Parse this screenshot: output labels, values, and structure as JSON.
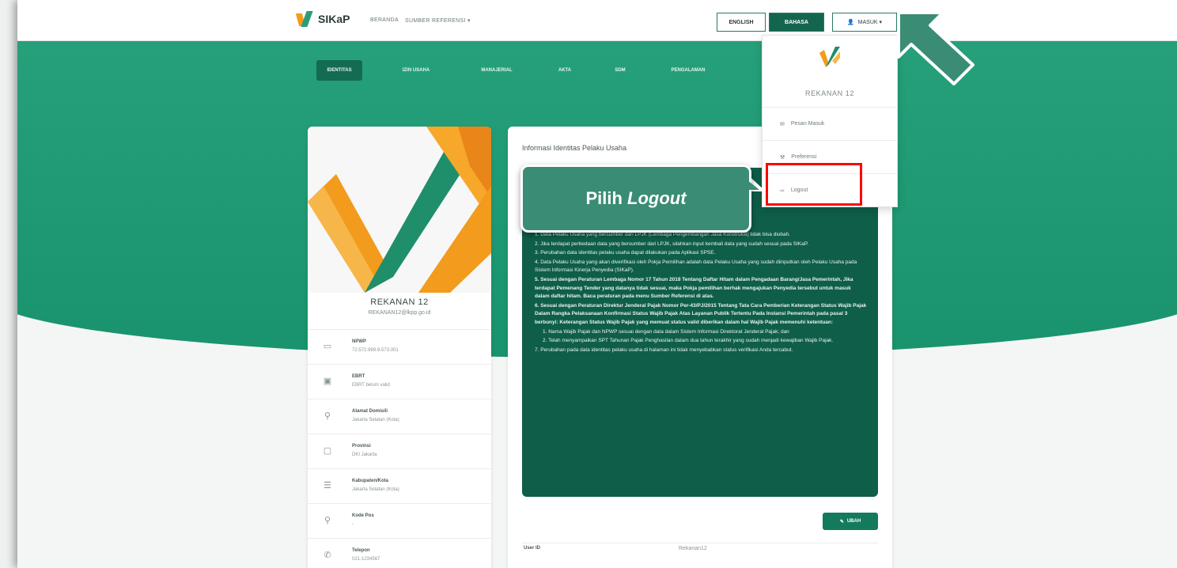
{
  "app": {
    "logo_text": "SIKaP"
  },
  "topnav": {
    "links": [
      "BERANDA",
      "SUMBER REFERENSI ▾"
    ]
  },
  "lang": {
    "english": "ENGLISH",
    "bahasa": "BAHASA"
  },
  "user_menu": {
    "label": "MASUK ▾"
  },
  "menu_tabs": [
    "IDENTITAS",
    "IZIN USAHA",
    "MANAJERIAL",
    "AKTA",
    "SDM",
    "PENGALAMAN"
  ],
  "profile": {
    "name": "REKANAN 12",
    "email": "REKANAN12@lkpp.go.id",
    "rows": [
      {
        "icon": "id-card-icon",
        "glyph": "▭",
        "label": "NPWP",
        "value": "72.572.999.9-573.001"
      },
      {
        "icon": "calendar-icon",
        "glyph": "▣",
        "label": "EBRT",
        "value": "EBRT belum valid"
      },
      {
        "icon": "location-icon",
        "glyph": "⚲",
        "label": "Alamat Domisili",
        "value": "Jakarta Selatan (Kota)"
      },
      {
        "icon": "map-icon",
        "glyph": "▢",
        "label": "Provinsi",
        "value": "DKI Jakarta"
      },
      {
        "icon": "building-icon",
        "glyph": "☰",
        "label": "Kabupaten/Kota",
        "value": "Jakarta Selatan (Kota)"
      },
      {
        "icon": "pin-icon",
        "glyph": "⚲",
        "label": "Kode Pos",
        "value": "-"
      },
      {
        "icon": "phone-icon",
        "glyph": "✆",
        "label": "Telepon",
        "value": "021-1234567"
      }
    ]
  },
  "info": {
    "title": "Informasi Identitas Pelaku Usaha",
    "notice_items": [
      {
        "text": "1. Data Pelaku Usaha yang bersumber dari LPJK (Lembaga Pengembangan Jasa Konstruksi) tidak bisa diubah.",
        "bold": false
      },
      {
        "text": "2. Jika terdapat perbedaan data yang bersumber dari LPJK, silahkan input kembali data yang sudah sesuai pada SIKaP.",
        "bold": false
      },
      {
        "text": "3. Perubahan data identitas pelaku usaha dapat dilakukan pada Aplikasi SPSE.",
        "bold": false
      },
      {
        "text": "4. Data Pelaku Usaha yang akan diverifikasi oleh Pokja Pemilihan adalah data Pelaku Usaha yang sudah diinputkan oleh Pelaku Usaha pada Sistem Informasi Kinerja Penyedia (SIKaP).",
        "bold": false
      },
      {
        "text": "5. Sesuai dengan Peraturan Lembaga Nomor 17 Tahun 2018 Tentang Daftar Hitam dalam Pengadaan Barang/Jasa Pemerintah, Jika terdapat Pemenang Tender yang datanya tidak sesuai, maka Pokja pemilihan berhak mengajukan Penyedia tersebut untuk masuk dalam daftar hitam. Baca peraturan pada menu Sumber Referensi di atas.",
        "bold": true
      },
      {
        "text": "6. Sesuai dengan Peraturan Direktur Jenderal Pajak Nomor Per-43/PJ/2015 Tentang Tata Cara Pemberian Keterangan Status Wajib Pajak Dalam Rangka Pelaksanaan Konfirmasi Status Wajib Pajak Atas Layanan Publik Tertentu Pada Instansi Pemerintah pada pasal 3 berbunyi: Keterangan Status Wajib Pajak yang memuat status valid diberikan dalam hal Wajib Pajak memenuhi ketentuan:",
        "bold": true
      },
      {
        "text": "1. Nama Wajib Pajak dan NPWP sesuai dengan data dalam Sistem Informasi Direktorat Jenderal Pajak; dan",
        "bold": false,
        "sub": true
      },
      {
        "text": "2. Telah menyampaikan SPT Tahunan Pajak Penghasilan dalam dua tahun terakhir yang sudah menjadi kewajiban Wajib Pajak.",
        "bold": false,
        "sub": true
      },
      {
        "text": "7. Perubahan pada data identitas pelaku usaha di halaman ini tidak menyebabkan status verifikasi Anda tercabut.",
        "bold": false
      }
    ],
    "edit_label": "UBAH",
    "user_id_label": "User ID",
    "user_id_value": "Rekanan12"
  },
  "dropdown": {
    "name": "REKANAN 12",
    "items": [
      {
        "icon": "mail-icon",
        "glyph": "✉",
        "label": "Pesan Masuk"
      },
      {
        "icon": "wrench-icon",
        "glyph": "⚒",
        "label": "Preferensi"
      },
      {
        "icon": "logout-icon",
        "glyph": "⇨",
        "label": "Logout"
      }
    ]
  },
  "callout": {
    "prefix": "Pilih ",
    "emphasis": "Logout"
  },
  "colors": {
    "primary": "#1a9b73",
    "dark": "#0f5e4a",
    "highlight": "#ff0000",
    "callout": "#3a8c75",
    "orange": "#f29b1d"
  }
}
